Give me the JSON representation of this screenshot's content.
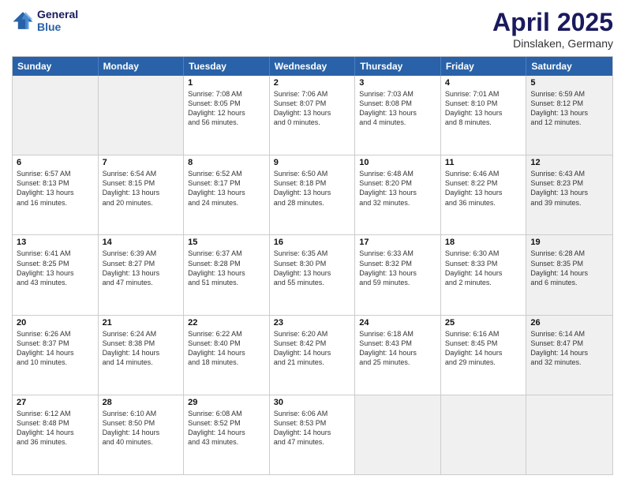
{
  "logo": {
    "line1": "General",
    "line2": "Blue"
  },
  "header": {
    "title": "April 2025",
    "location": "Dinslaken, Germany"
  },
  "weekdays": [
    "Sunday",
    "Monday",
    "Tuesday",
    "Wednesday",
    "Thursday",
    "Friday",
    "Saturday"
  ],
  "rows": [
    [
      {
        "day": "",
        "info": "",
        "shaded": true
      },
      {
        "day": "",
        "info": "",
        "shaded": true
      },
      {
        "day": "1",
        "info": "Sunrise: 7:08 AM\nSunset: 8:05 PM\nDaylight: 12 hours\nand 56 minutes.",
        "shaded": false
      },
      {
        "day": "2",
        "info": "Sunrise: 7:06 AM\nSunset: 8:07 PM\nDaylight: 13 hours\nand 0 minutes.",
        "shaded": false
      },
      {
        "day": "3",
        "info": "Sunrise: 7:03 AM\nSunset: 8:08 PM\nDaylight: 13 hours\nand 4 minutes.",
        "shaded": false
      },
      {
        "day": "4",
        "info": "Sunrise: 7:01 AM\nSunset: 8:10 PM\nDaylight: 13 hours\nand 8 minutes.",
        "shaded": false
      },
      {
        "day": "5",
        "info": "Sunrise: 6:59 AM\nSunset: 8:12 PM\nDaylight: 13 hours\nand 12 minutes.",
        "shaded": true
      }
    ],
    [
      {
        "day": "6",
        "info": "Sunrise: 6:57 AM\nSunset: 8:13 PM\nDaylight: 13 hours\nand 16 minutes.",
        "shaded": false
      },
      {
        "day": "7",
        "info": "Sunrise: 6:54 AM\nSunset: 8:15 PM\nDaylight: 13 hours\nand 20 minutes.",
        "shaded": false
      },
      {
        "day": "8",
        "info": "Sunrise: 6:52 AM\nSunset: 8:17 PM\nDaylight: 13 hours\nand 24 minutes.",
        "shaded": false
      },
      {
        "day": "9",
        "info": "Sunrise: 6:50 AM\nSunset: 8:18 PM\nDaylight: 13 hours\nand 28 minutes.",
        "shaded": false
      },
      {
        "day": "10",
        "info": "Sunrise: 6:48 AM\nSunset: 8:20 PM\nDaylight: 13 hours\nand 32 minutes.",
        "shaded": false
      },
      {
        "day": "11",
        "info": "Sunrise: 6:46 AM\nSunset: 8:22 PM\nDaylight: 13 hours\nand 36 minutes.",
        "shaded": false
      },
      {
        "day": "12",
        "info": "Sunrise: 6:43 AM\nSunset: 8:23 PM\nDaylight: 13 hours\nand 39 minutes.",
        "shaded": true
      }
    ],
    [
      {
        "day": "13",
        "info": "Sunrise: 6:41 AM\nSunset: 8:25 PM\nDaylight: 13 hours\nand 43 minutes.",
        "shaded": false
      },
      {
        "day": "14",
        "info": "Sunrise: 6:39 AM\nSunset: 8:27 PM\nDaylight: 13 hours\nand 47 minutes.",
        "shaded": false
      },
      {
        "day": "15",
        "info": "Sunrise: 6:37 AM\nSunset: 8:28 PM\nDaylight: 13 hours\nand 51 minutes.",
        "shaded": false
      },
      {
        "day": "16",
        "info": "Sunrise: 6:35 AM\nSunset: 8:30 PM\nDaylight: 13 hours\nand 55 minutes.",
        "shaded": false
      },
      {
        "day": "17",
        "info": "Sunrise: 6:33 AM\nSunset: 8:32 PM\nDaylight: 13 hours\nand 59 minutes.",
        "shaded": false
      },
      {
        "day": "18",
        "info": "Sunrise: 6:30 AM\nSunset: 8:33 PM\nDaylight: 14 hours\nand 2 minutes.",
        "shaded": false
      },
      {
        "day": "19",
        "info": "Sunrise: 6:28 AM\nSunset: 8:35 PM\nDaylight: 14 hours\nand 6 minutes.",
        "shaded": true
      }
    ],
    [
      {
        "day": "20",
        "info": "Sunrise: 6:26 AM\nSunset: 8:37 PM\nDaylight: 14 hours\nand 10 minutes.",
        "shaded": false
      },
      {
        "day": "21",
        "info": "Sunrise: 6:24 AM\nSunset: 8:38 PM\nDaylight: 14 hours\nand 14 minutes.",
        "shaded": false
      },
      {
        "day": "22",
        "info": "Sunrise: 6:22 AM\nSunset: 8:40 PM\nDaylight: 14 hours\nand 18 minutes.",
        "shaded": false
      },
      {
        "day": "23",
        "info": "Sunrise: 6:20 AM\nSunset: 8:42 PM\nDaylight: 14 hours\nand 21 minutes.",
        "shaded": false
      },
      {
        "day": "24",
        "info": "Sunrise: 6:18 AM\nSunset: 8:43 PM\nDaylight: 14 hours\nand 25 minutes.",
        "shaded": false
      },
      {
        "day": "25",
        "info": "Sunrise: 6:16 AM\nSunset: 8:45 PM\nDaylight: 14 hours\nand 29 minutes.",
        "shaded": false
      },
      {
        "day": "26",
        "info": "Sunrise: 6:14 AM\nSunset: 8:47 PM\nDaylight: 14 hours\nand 32 minutes.",
        "shaded": true
      }
    ],
    [
      {
        "day": "27",
        "info": "Sunrise: 6:12 AM\nSunset: 8:48 PM\nDaylight: 14 hours\nand 36 minutes.",
        "shaded": false
      },
      {
        "day": "28",
        "info": "Sunrise: 6:10 AM\nSunset: 8:50 PM\nDaylight: 14 hours\nand 40 minutes.",
        "shaded": false
      },
      {
        "day": "29",
        "info": "Sunrise: 6:08 AM\nSunset: 8:52 PM\nDaylight: 14 hours\nand 43 minutes.",
        "shaded": false
      },
      {
        "day": "30",
        "info": "Sunrise: 6:06 AM\nSunset: 8:53 PM\nDaylight: 14 hours\nand 47 minutes.",
        "shaded": false
      },
      {
        "day": "",
        "info": "",
        "shaded": true
      },
      {
        "day": "",
        "info": "",
        "shaded": true
      },
      {
        "day": "",
        "info": "",
        "shaded": true
      }
    ]
  ]
}
